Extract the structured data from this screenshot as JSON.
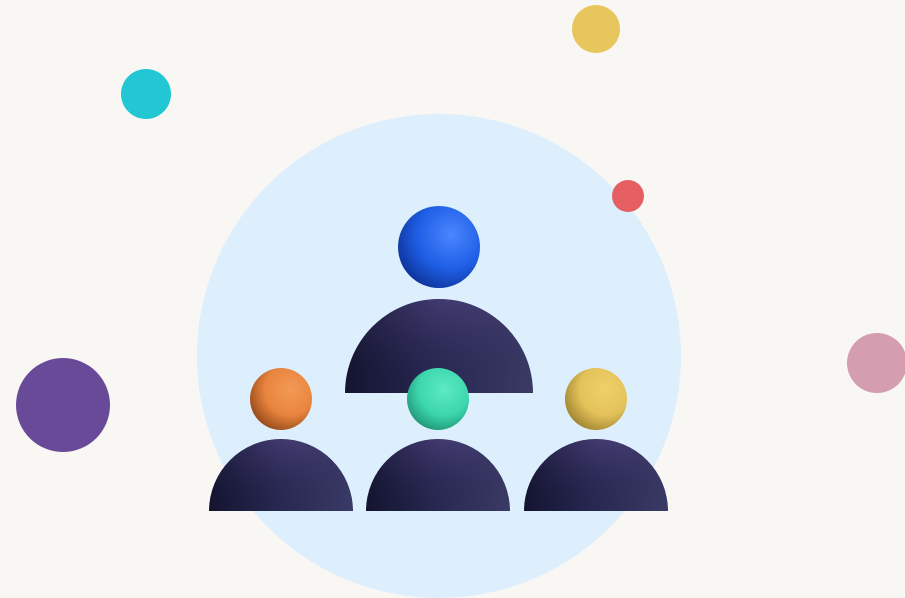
{
  "illustration": {
    "subject": "team-hierarchy-icon",
    "background_color": "#f9f7f4",
    "backdrop_circle_color": "#ddeefc",
    "body_color": "#2a2a50",
    "leader": {
      "head_color": "#1f5fe6"
    },
    "members": [
      {
        "head_color": "#e8843e"
      },
      {
        "head_color": "#3cd6ad"
      },
      {
        "head_color": "#e3c25a"
      }
    ],
    "decorative_dots": [
      {
        "name": "teal-dot",
        "color": "#22c7d3"
      },
      {
        "name": "yellow-dot",
        "color": "#e8c65e"
      },
      {
        "name": "red-dot",
        "color": "#e55f62"
      },
      {
        "name": "purple-dot",
        "color": "#694a98"
      },
      {
        "name": "pink-dot",
        "color": "#d59db0"
      }
    ]
  }
}
